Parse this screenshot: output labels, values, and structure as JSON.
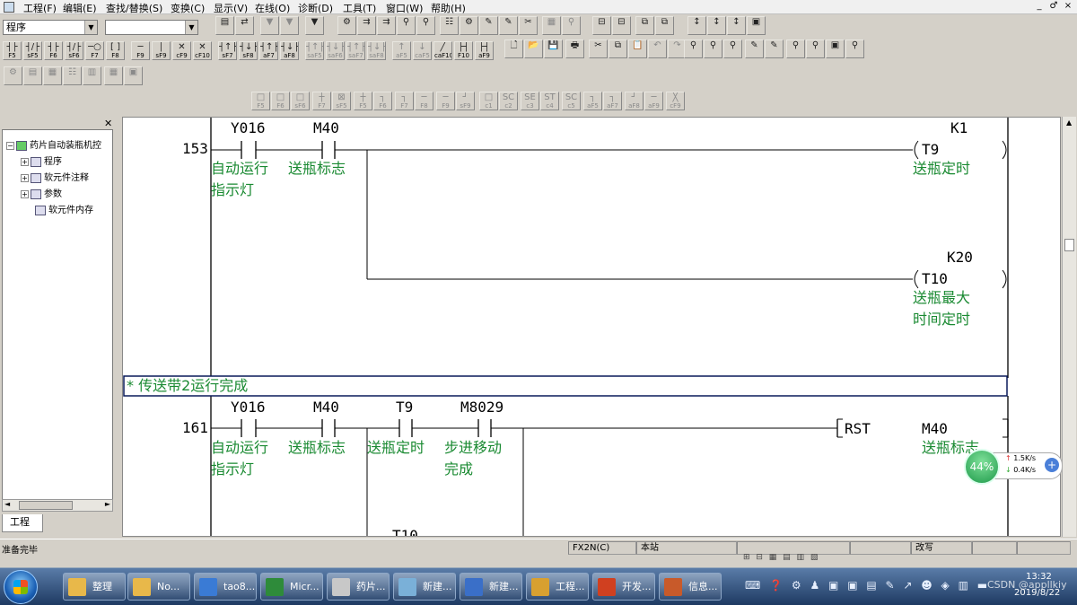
{
  "menubar": {
    "items": [
      "工程(F)",
      "编辑(E)",
      "查找/替换(S)",
      "变换(C)",
      "显示(V)",
      "在线(O)",
      "诊断(D)",
      "工具(T)",
      "窗口(W)",
      "帮助(H)"
    ],
    "window_controls": [
      "_",
      "♂",
      "×"
    ]
  },
  "toolbar": {
    "program_select": "程序",
    "second_select": "",
    "ladder_buttons": [
      {
        "glyph": "┤├",
        "label": "F5"
      },
      {
        "glyph": "┤/├",
        "label": "sF5"
      },
      {
        "glyph": "┤├",
        "label": "F6"
      },
      {
        "glyph": "┤/├",
        "label": "sF6"
      },
      {
        "glyph": "─○",
        "label": "F7"
      },
      {
        "glyph": "[ ]",
        "label": "F8"
      },
      {
        "glyph": "─",
        "label": "F9"
      },
      {
        "glyph": "│",
        "label": "sF9"
      },
      {
        "glyph": "✕",
        "label": "cF9"
      },
      {
        "glyph": "✕",
        "label": "cF10"
      },
      {
        "glyph": "┤↑├",
        "label": "sF7"
      },
      {
        "glyph": "┤↓├",
        "label": "sF8"
      },
      {
        "glyph": "┤↑├",
        "label": "aF7"
      },
      {
        "glyph": "┤↓├",
        "label": "aF8"
      },
      {
        "glyph": "┤↑├",
        "label": "saF5"
      },
      {
        "glyph": "┤↓├",
        "label": "saF6"
      },
      {
        "glyph": "┤↑├",
        "label": "saF7"
      },
      {
        "glyph": "┤↓├",
        "label": "saF8"
      },
      {
        "glyph": "↑",
        "label": "aF5"
      },
      {
        "glyph": "↓",
        "label": "caF5"
      },
      {
        "glyph": "╱",
        "label": "caF10"
      },
      {
        "glyph": "├┤",
        "label": "F10"
      },
      {
        "glyph": "├┤",
        "label": "aF9"
      }
    ],
    "sfc_buttons": [
      {
        "glyph": "□",
        "label": "F5"
      },
      {
        "glyph": "□",
        "label": "F6"
      },
      {
        "glyph": "□",
        "label": "sF6"
      },
      {
        "glyph": "┼",
        "label": "F7"
      },
      {
        "glyph": "⊠",
        "label": "sF5"
      },
      {
        "glyph": "┼",
        "label": "F5"
      },
      {
        "glyph": "┐",
        "label": "F6"
      },
      {
        "glyph": "┐",
        "label": "F7"
      },
      {
        "glyph": "─",
        "label": "F8"
      },
      {
        "glyph": "─",
        "label": "F9"
      },
      {
        "glyph": "┘",
        "label": "sF9"
      },
      {
        "glyph": "□",
        "label": "c1"
      },
      {
        "glyph": "SC",
        "label": "c2"
      },
      {
        "glyph": "SE",
        "label": "c3"
      },
      {
        "glyph": "ST",
        "label": "c4"
      },
      {
        "glyph": "SC",
        "label": "c5"
      },
      {
        "glyph": "┐",
        "label": "aF5"
      },
      {
        "glyph": "┐",
        "label": "aF7"
      },
      {
        "glyph": "┘",
        "label": "aF8"
      },
      {
        "glyph": "─",
        "label": "aF9"
      },
      {
        "glyph": "╳",
        "label": "cF9"
      }
    ]
  },
  "tree": {
    "root": "药片自动装瓶机控",
    "items": [
      "程序",
      "软元件注释",
      "参数",
      "软元件内存"
    ],
    "tab": "工程"
  },
  "ladder": {
    "rung1": {
      "step": "153",
      "contacts": [
        {
          "device": "Y016",
          "comment": [
            "自动运行",
            "指示灯"
          ]
        },
        {
          "device": "M40",
          "comment": [
            "送瓶标志"
          ]
        }
      ],
      "coils": [
        {
          "constant": "K1",
          "device": "T9",
          "comment": [
            "送瓶定时"
          ]
        },
        {
          "constant": "K20",
          "device": "T10",
          "comment": [
            "送瓶最大",
            "时间定时"
          ]
        }
      ]
    },
    "statement": "* 传送带2运行完成",
    "rung2": {
      "step": "161",
      "contacts": [
        {
          "device": "Y016",
          "comment": [
            "自动运行",
            "指示灯"
          ]
        },
        {
          "device": "M40",
          "comment": [
            "送瓶标志"
          ]
        },
        {
          "device": "T9",
          "comment": [
            "送瓶定时"
          ]
        },
        {
          "device": "M8029",
          "comment": [
            "步进移动",
            "完成"
          ]
        }
      ],
      "instruction": "RST",
      "operand": "M40",
      "operand_comment": "送瓶标志",
      "next_device": "T10"
    }
  },
  "statusbar": {
    "ready": "准备完毕",
    "plc": "FX2N(C)",
    "station": "本站",
    "mode": "改写"
  },
  "netmeter": {
    "percent": "44%",
    "up": "1.5K/s",
    "down": "0.4K/s"
  },
  "taskbar": {
    "buttons": [
      {
        "label": "整理",
        "color": "#e8b84a"
      },
      {
        "label": "No...",
        "color": "#e8b84a"
      },
      {
        "label": "tao8...",
        "color": "#3a7bd5"
      },
      {
        "label": "Micr...",
        "color": "#2e8b3a"
      },
      {
        "label": "药片...",
        "color": "#c8c8c8"
      },
      {
        "label": "新建...",
        "color": "#7ab0d8"
      },
      {
        "label": "新建...",
        "color": "#3a6fc8"
      },
      {
        "label": "工程...",
        "color": "#d8a030"
      },
      {
        "label": "开发...",
        "color": "#d04020"
      },
      {
        "label": "信息...",
        "color": "#c85a2a"
      }
    ],
    "time": "13:32",
    "date": "2019/8/22",
    "watermark": "CSDN @appllkiy"
  }
}
